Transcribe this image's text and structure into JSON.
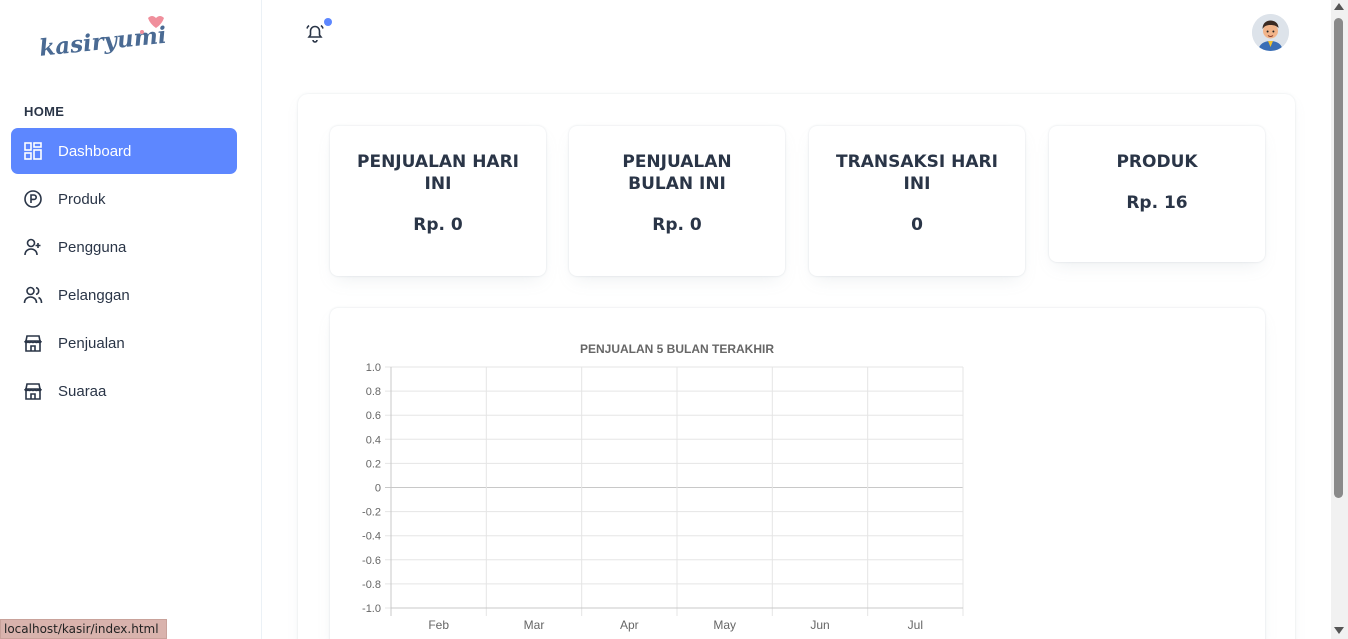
{
  "app": {
    "logo_text": "kasiryumi"
  },
  "sidebar": {
    "section_label": "HOME",
    "items": [
      {
        "label": "Dashboard",
        "icon": "dashboard-icon",
        "active": true
      },
      {
        "label": "Produk",
        "icon": "product-circle-p-icon"
      },
      {
        "label": "Pengguna",
        "icon": "user-plus-icon"
      },
      {
        "label": "Pelanggan",
        "icon": "users-icon"
      },
      {
        "label": "Penjualan",
        "icon": "store-icon"
      },
      {
        "label": "Suaraa",
        "icon": "store-icon"
      }
    ]
  },
  "topbar": {
    "notification_icon": "bell-icon",
    "avatar_icon": "user-avatar"
  },
  "stats": [
    {
      "title": "PENJUALAN HARI INI",
      "value": "Rp. 0"
    },
    {
      "title": "PENJUALAN BULAN INI",
      "value": "Rp. 0"
    },
    {
      "title": "TRANSAKSI HARI INI",
      "value": "0"
    },
    {
      "title": "PRODUK",
      "value": "Rp. 16"
    }
  ],
  "colors": {
    "accent": "#5d87ff",
    "text": "#2a3547"
  },
  "chart_data": {
    "type": "line",
    "title": "PENJUALAN 5 BULAN TERAKHIR",
    "categories": [
      "Feb",
      "Mar",
      "Apr",
      "May",
      "Jun",
      "Jul"
    ],
    "series": [],
    "ylim": [
      -1.0,
      1.0
    ],
    "yticks": [
      "1.0",
      "0.8",
      "0.6",
      "0.4",
      "0.2",
      "0",
      "-0.2",
      "-0.4",
      "-0.6",
      "-0.8",
      "-1.0"
    ],
    "grid": true,
    "legend": "none"
  },
  "status_bar": {
    "url": "localhost/kasir/index.html"
  }
}
